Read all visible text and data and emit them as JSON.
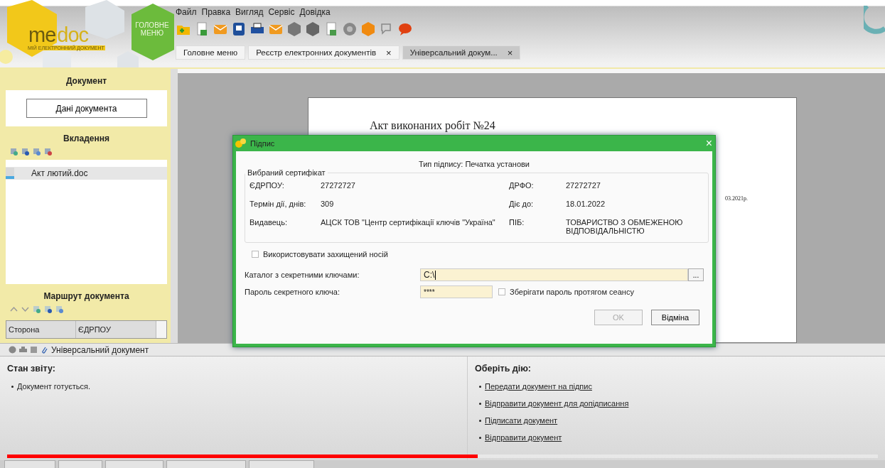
{
  "app": {
    "brand_left": "me",
    "brand_right": "doc",
    "tagline": "МІЙ ЕЛЕКТРОННИЙ ДОКУМЕНТ",
    "home_button": "ГОЛОВНЕ МЕНЮ"
  },
  "menu": [
    "Файл",
    "Правка",
    "Вигляд",
    "Сервіс",
    "Довідка"
  ],
  "tabs": [
    {
      "label": "Головне меню",
      "selected": false
    },
    {
      "label": "Реєстр електронних документів",
      "selected": false,
      "close": "×"
    },
    {
      "label": "Універсальний докум...",
      "selected": true,
      "close": "×"
    }
  ],
  "sidebar": {
    "document_title": "Документ",
    "data_button": "Дані документа",
    "attachments_title": "Вкладення",
    "attachments": [
      {
        "name": "Акт лютий.doc",
        "selected": true
      }
    ],
    "route_title": "Маршрут документа",
    "route_columns": [
      "Сторона",
      "ЄДРПОУ"
    ]
  },
  "document": {
    "title": "Акт виконаних робіт №24",
    "date_fragment": "03.2021р."
  },
  "dialog": {
    "title": "Підпис",
    "close": "×",
    "signature_type": "Тип підпису: Печатка установи",
    "group_title": "Вибраний сертифікат",
    "rows": [
      {
        "left_label": "ЄДРПОУ:",
        "left_value": "27272727",
        "right_label": "ДРФО:",
        "right_value": "27272727"
      },
      {
        "left_label": "Термін дії, днів:",
        "left_value": "309",
        "right_label": "Діє до:",
        "right_value": "18.01.2022"
      },
      {
        "left_label": "Видавець:",
        "left_value": "АЦСК ТОВ \"Центр сертифікації ключів \"Україна\"",
        "right_label": "ПІБ:",
        "right_value": "ТОВАРИСТВО З ОБМЕЖЕНОЮ ВІДПОВІДАЛЬНІСТЮ"
      }
    ],
    "protected_media": {
      "label": "Використовувати захищений носій",
      "checked": false
    },
    "key_dir": {
      "label": "Каталог з секретними ключами:",
      "value": "C:\\",
      "browse": "..."
    },
    "password": {
      "label": "Пароль секретного ключа:",
      "value": "****"
    },
    "remember": {
      "label": "Зберігати пароль протягом сеансу",
      "checked": false
    },
    "ok": {
      "label": "OK",
      "disabled": true
    },
    "cancel": "Відміна"
  },
  "bottom": {
    "panel_title": "Універсальний документ",
    "status_title": "Стан звіту:",
    "status_items": [
      "Документ готується."
    ],
    "actions_title": "Оберіть дію:",
    "actions": [
      "Передати документ на підпис",
      "Відправити документ для допідписання",
      "Підписати документ",
      "Відправити документ"
    ]
  },
  "video": {
    "progress": {
      "level": 0.54
    }
  }
}
